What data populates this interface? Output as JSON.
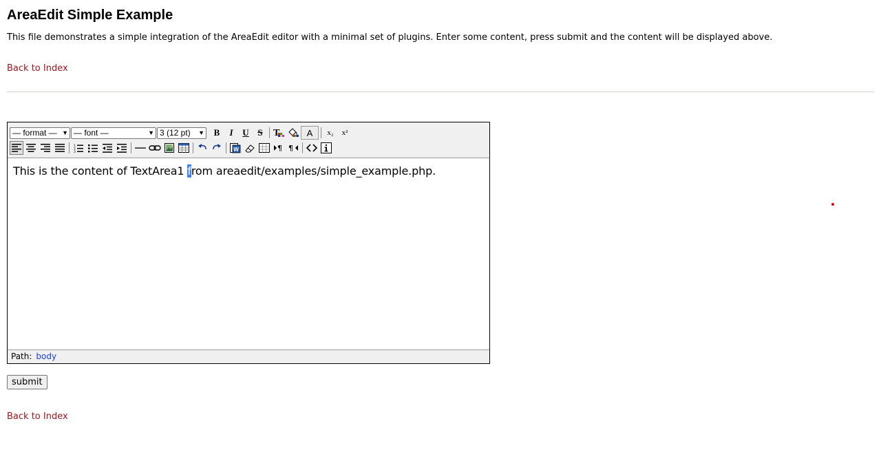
{
  "page": {
    "title": "AreaEdit Simple Example",
    "intro": "This file demonstrates a simple integration of the AreaEdit editor with a minimal set of plugins. Enter some content, press submit and the content will be displayed above.",
    "back_link_top": "Back to Index",
    "back_link_bottom": "Back to Index"
  },
  "editor": {
    "selects": {
      "format": "— format —",
      "font": "— font —",
      "size": "3 (12 pt)"
    },
    "toolbar_row1": [
      {
        "name": "bold-button",
        "glyph": "B"
      },
      {
        "name": "italic-button",
        "glyph": "I"
      },
      {
        "name": "underline-button",
        "glyph": "U"
      },
      {
        "name": "strikethrough-button",
        "glyph": "S"
      },
      {
        "name": "text-color-button",
        "glyph": "T"
      },
      {
        "name": "background-color-button",
        "glyph": "fill"
      },
      {
        "name": "font-color-button",
        "glyph": "A"
      },
      {
        "name": "subscript-button",
        "glyph": "x₂"
      },
      {
        "name": "superscript-button",
        "glyph": "x²"
      }
    ],
    "content": {
      "before_caret": "This is the content of TextArea1 ",
      "caret_char": "f",
      "after_caret": "rom areaedit/examples/simple_example.php."
    },
    "statusbar": {
      "label": "Path:",
      "path": "body"
    }
  },
  "form": {
    "submit_label": "submit"
  },
  "colors": {
    "link": "#a0141e",
    "path_link": "#1f3ee8",
    "toolbar_bg": "#f0f0f0",
    "rule": "#d4d0c8",
    "selection": "#3b82f6"
  }
}
